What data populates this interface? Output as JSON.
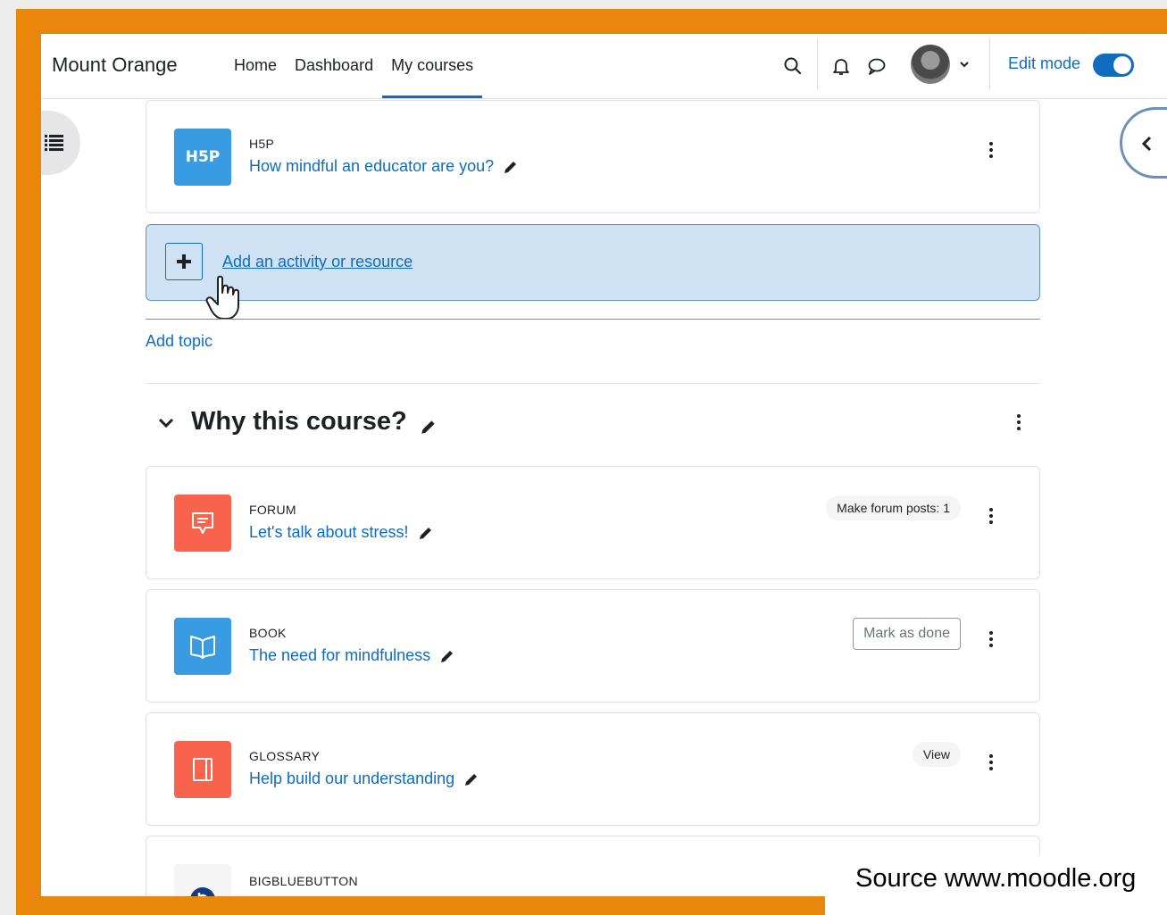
{
  "navbar": {
    "brand": "Mount Orange",
    "links": [
      {
        "label": "Home",
        "active": false
      },
      {
        "label": "Dashboard",
        "active": false
      },
      {
        "label": "My courses",
        "active": true
      }
    ],
    "icons": [
      "search-icon",
      "bell-icon",
      "chat-icon",
      "avatar",
      "chevron-down-icon"
    ],
    "edit_mode_label": "Edit mode",
    "edit_mode_on": true
  },
  "drawers": {
    "left_icon": "list-icon",
    "right_icon": "chevron-left-icon"
  },
  "activities_top": [
    {
      "type": "H5P",
      "name": "How mindful an educator are you?",
      "icon": "h5p-icon",
      "icon_label": "H5P",
      "color": "#399be2"
    }
  ],
  "add_activity": {
    "label": "Add an activity or resource",
    "icon": "plus-icon"
  },
  "add_topic": "Add topic",
  "section": {
    "title": "Why this course?",
    "activities": [
      {
        "type": "FORUM",
        "name": "Let's talk about stress!",
        "icon": "forum-icon",
        "color": "#f7634d",
        "completion_badge": "Make forum posts: 1"
      },
      {
        "type": "BOOK",
        "name": "The need for mindfulness",
        "icon": "book-icon",
        "color": "#399be2",
        "completion_button": "Mark as done"
      },
      {
        "type": "GLOSSARY",
        "name": "Help build our understanding",
        "icon": "glossary-icon",
        "color": "#f7634d",
        "completion_badge": "View"
      },
      {
        "type": "BIGBLUEBUTTON",
        "name": "",
        "icon": "bigbluebutton-icon",
        "color": "#ffffff"
      }
    ]
  },
  "footer_note": "Source www.moodle.org",
  "colors": {
    "frame": "#e8870b",
    "link": "#0f6cbf",
    "add_box_bg": "#cfe2f3"
  }
}
